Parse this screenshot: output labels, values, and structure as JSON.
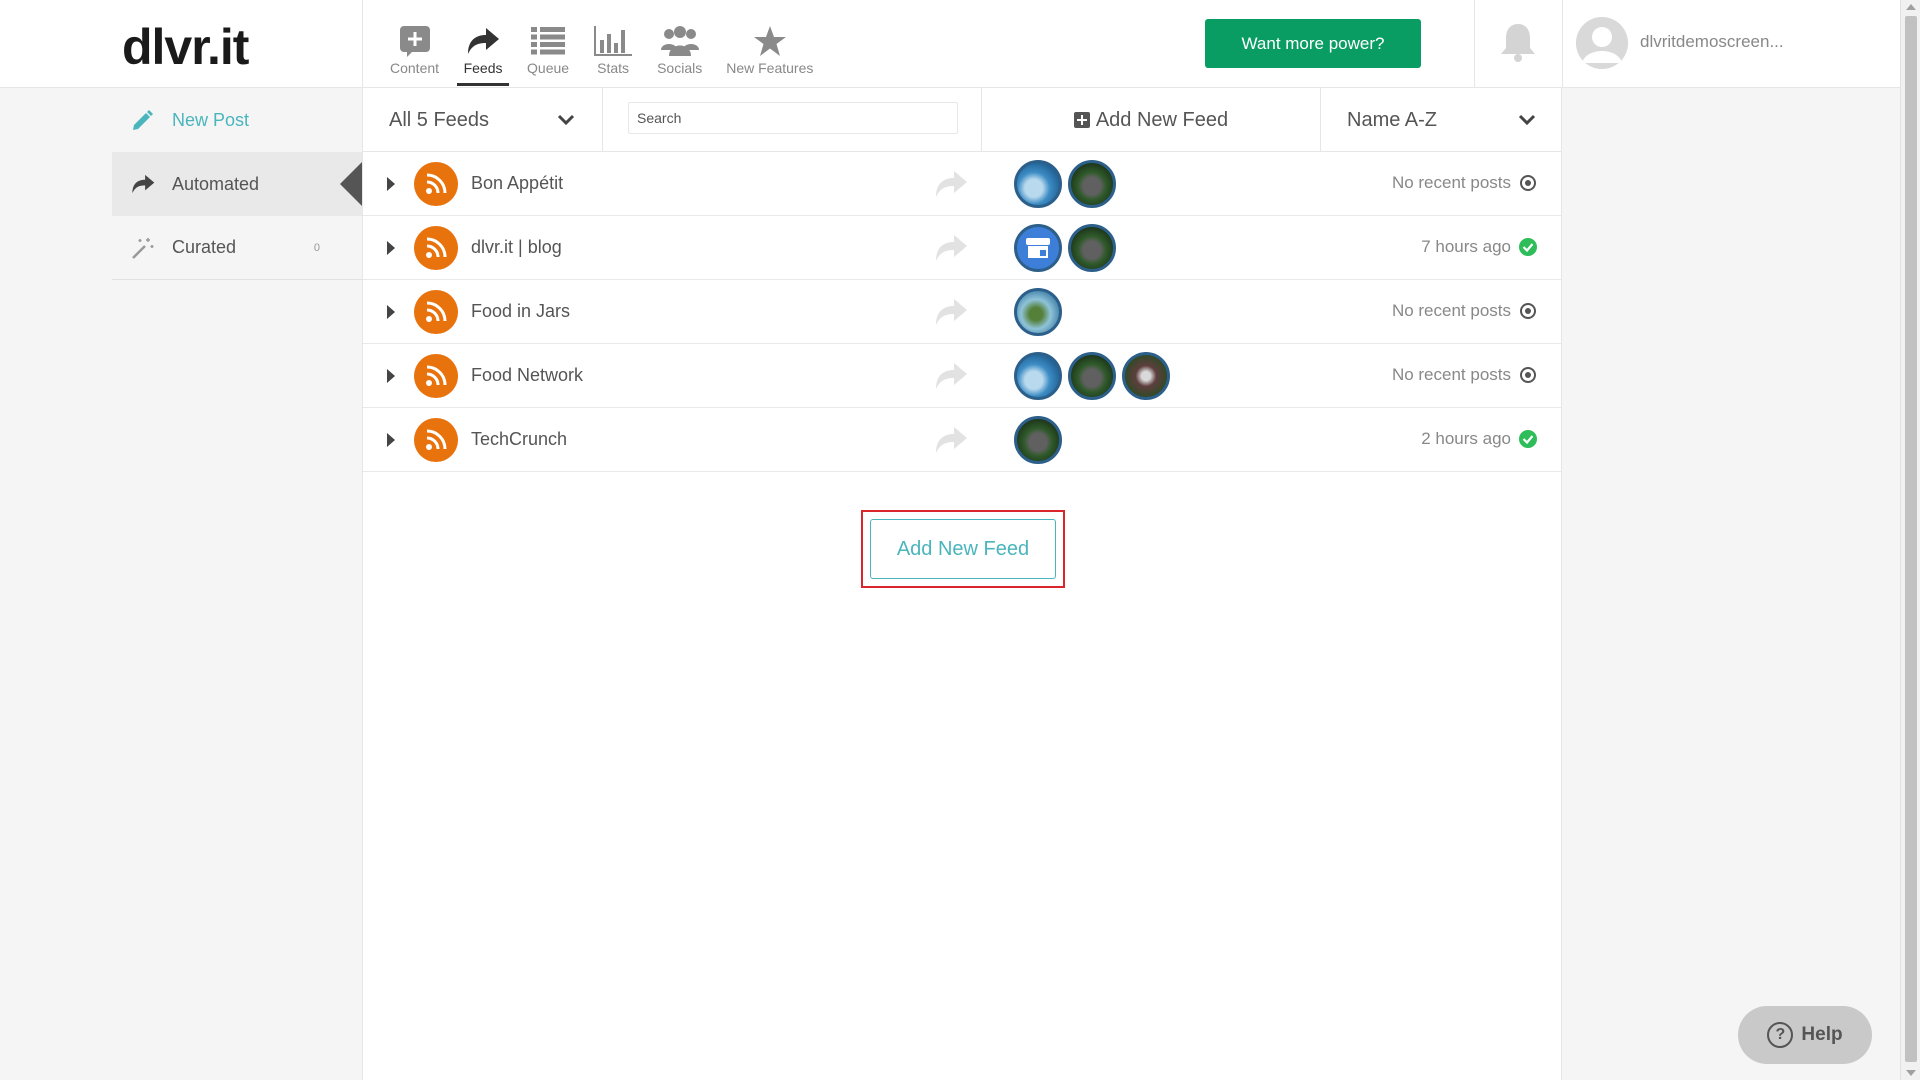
{
  "header": {
    "logo": "dlvr.it",
    "nav": [
      {
        "label": "Content",
        "icon": "plus-square-icon"
      },
      {
        "label": "Feeds",
        "icon": "share-arrow-icon",
        "active": true
      },
      {
        "label": "Queue",
        "icon": "list-icon"
      },
      {
        "label": "Stats",
        "icon": "bar-chart-icon"
      },
      {
        "label": "Socials",
        "icon": "users-icon"
      },
      {
        "label": "New Features",
        "icon": "star-icon"
      }
    ],
    "power_button": "Want more power?",
    "username": "dlvritdemoscreen..."
  },
  "sidebar": {
    "items": [
      {
        "label": "New Post",
        "icon": "pencil-icon"
      },
      {
        "label": "Automated",
        "icon": "share-arrow-icon",
        "active": true
      },
      {
        "label": "Curated",
        "icon": "magic-wand-icon",
        "count": "0"
      }
    ]
  },
  "toolbar": {
    "filter_label": "All 5 Feeds",
    "search_placeholder": "Search",
    "add_feed_label": "Add New Feed",
    "sort_label": "Name A-Z"
  },
  "feeds": [
    {
      "name": "Bon Appétit",
      "status": "No recent posts",
      "status_type": "inactive"
    },
    {
      "name": "dlvr.it | blog",
      "status": "7 hours ago",
      "status_type": "active"
    },
    {
      "name": "Food in Jars",
      "status": "No recent posts",
      "status_type": "inactive"
    },
    {
      "name": "Food Network",
      "status": "No recent posts",
      "status_type": "inactive"
    },
    {
      "name": "TechCrunch",
      "status": "2 hours ago",
      "status_type": "active"
    }
  ],
  "add_feed_button": "Add New Feed",
  "help_button": "Help",
  "colors": {
    "accent": "#4ab5bd",
    "power_green": "#0a9d63",
    "rss_orange": "#e8720c",
    "status_green": "#2ebd59",
    "highlight_red": "#d9252b"
  }
}
